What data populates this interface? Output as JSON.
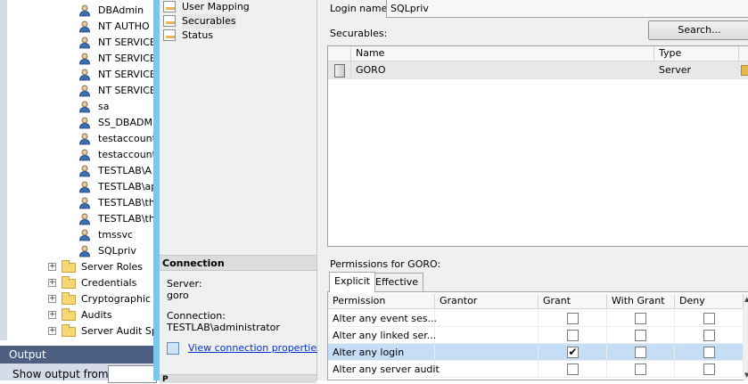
{
  "object_explorer": {
    "logins": [
      "DBAdmin",
      "NT AUTHO",
      "NT SERVICE",
      "NT SERVICE",
      "NT SERVICE",
      "NT SERVICE",
      "sa",
      "SS_DBADMI",
      "testaccount",
      "testaccount",
      "TESTLAB\\A",
      "TESTLAB\\ap",
      "TESTLAB\\th",
      "TESTLAB\\th",
      "tmssvc",
      "SQLpriv"
    ],
    "folders": [
      "Server Roles",
      "Credentials",
      "Cryptographic",
      "Audits",
      "Server Audit Sp"
    ],
    "login_icon": "user-icon",
    "folder_icon": "folder-icon"
  },
  "output_pane": {
    "title": "Output",
    "show_output_label": "Show output from:"
  },
  "pages": {
    "items": [
      "User Mapping",
      "Securables",
      "Status"
    ],
    "selected": "Securables"
  },
  "connection": {
    "title": "Connection",
    "server_label": "Server:",
    "server_value": "goro",
    "connection_label": "Connection:",
    "connection_value": "TESTLAB\\administrator",
    "view_link": "View connection properties",
    "progress_title": "P"
  },
  "main": {
    "login_name_label": "Login name:",
    "login_name_value": "SQLpriv",
    "securables_label": "Securables:",
    "search_button": "Search...",
    "securables_columns": [
      "Name",
      "Type"
    ],
    "securables_rows": [
      {
        "name": "GORO",
        "type": "Server"
      }
    ],
    "permissions_label": "Permissions for GORO:",
    "tabs": [
      "Explicit",
      "Effective"
    ],
    "active_tab": "Explicit",
    "permission_columns": [
      "Permission",
      "Grantor",
      "Grant",
      "With Grant",
      "Deny"
    ],
    "permission_rows": [
      {
        "permission": "Alter any event ses...",
        "grantor": "",
        "grant": false,
        "with_grant": false,
        "deny": false
      },
      {
        "permission": "Alter any linked ser...",
        "grantor": "",
        "grant": false,
        "with_grant": false,
        "deny": false
      },
      {
        "permission": "Alter any login",
        "grantor": "",
        "grant": true,
        "with_grant": false,
        "deny": false
      },
      {
        "permission": "Alter any server audit",
        "grantor": "",
        "grant": false,
        "with_grant": false,
        "deny": false
      }
    ],
    "checkmark_glyph": "✔"
  },
  "colors": {
    "frame_blue": "#79c8e9",
    "selected_row": "#c5ddf5",
    "output_title_bg": "#4d6082",
    "link": "#0033cc"
  }
}
